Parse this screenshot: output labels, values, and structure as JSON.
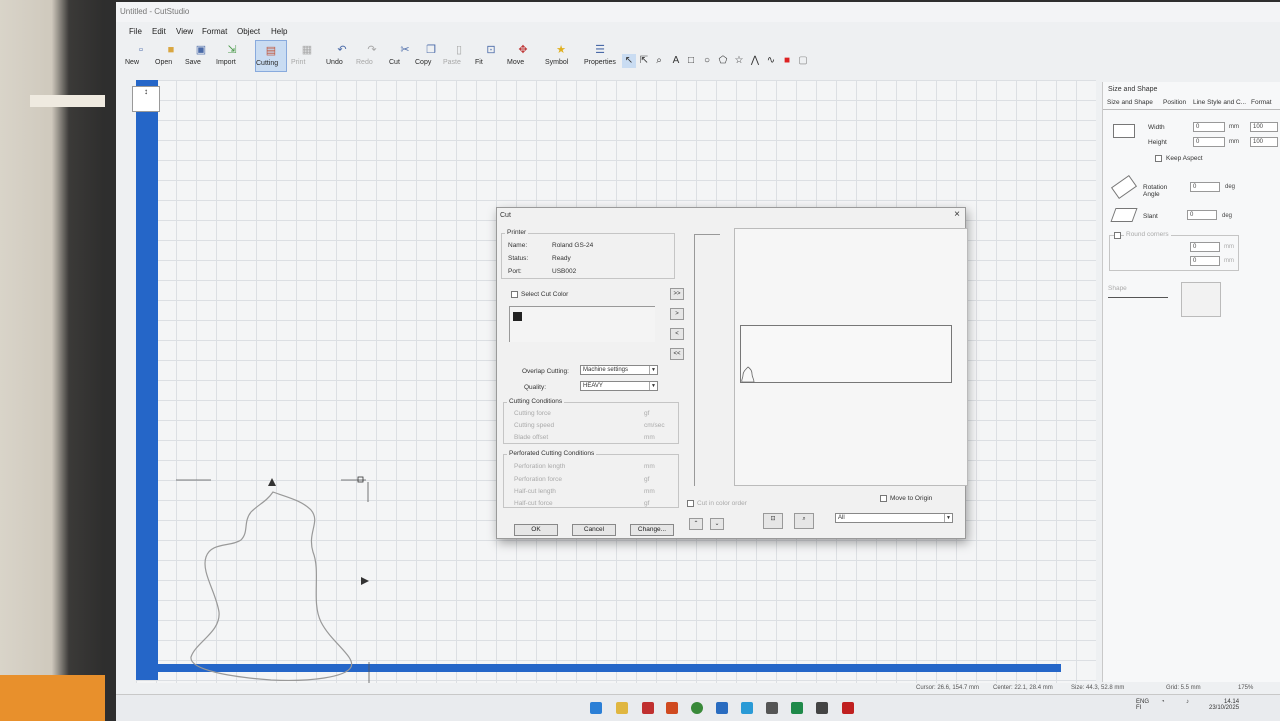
{
  "window": {
    "title": "Untitled - CutStudio"
  },
  "menu": [
    "File",
    "Edit",
    "View",
    "Format",
    "Object",
    "Help"
  ],
  "toolbar": {
    "buttons": [
      {
        "label": "New",
        "icon": "new-file-icon"
      },
      {
        "label": "Open",
        "icon": "folder-open-icon"
      },
      {
        "label": "Save",
        "icon": "save-disk-icon"
      },
      {
        "label": "Import",
        "icon": "import-icon"
      },
      {
        "label": "Cutting",
        "icon": "cutting-plotter-icon"
      },
      {
        "label": "Print",
        "icon": "printer-icon"
      },
      {
        "label": "Undo",
        "icon": "undo-icon"
      },
      {
        "label": "Redo",
        "icon": "redo-icon"
      },
      {
        "label": "Cut",
        "icon": "scissors-icon"
      },
      {
        "label": "Copy",
        "icon": "copy-icon"
      },
      {
        "label": "Paste",
        "icon": "paste-icon"
      },
      {
        "label": "Fit",
        "icon": "fit-icon"
      },
      {
        "label": "Move",
        "icon": "move-icon"
      },
      {
        "label": "Symbol",
        "icon": "star-icon"
      },
      {
        "label": "Properties",
        "icon": "properties-icon"
      }
    ],
    "draw_tools": [
      "pointer-icon",
      "node-edit-icon",
      "zoom-icon",
      "text-icon",
      "rectangle-icon",
      "ellipse-icon",
      "polygon-icon",
      "star-shape-icon",
      "pen-icon",
      "freehand-icon",
      "fill-color-icon",
      "outline-icon"
    ]
  },
  "panel": {
    "title": "Size and Shape",
    "tabs": [
      "Size and Shape",
      "Position",
      "Line Style and C...",
      "Format"
    ],
    "width_label": "Width",
    "height_label": "Height",
    "width_value": "0",
    "height_value": "0",
    "width_pct": "100",
    "height_pct": "100",
    "unit_mm": "mm",
    "keep_aspect": "Keep Aspect",
    "rotation_label": "Rotation Angle",
    "rotation_value": "0",
    "slant_label": "Slant",
    "slant_value": "0",
    "unit_deg": "deg",
    "round_corners": "Round corners",
    "rc_value1": "0",
    "rc_value2": "0",
    "shape_label": "Shape"
  },
  "dialog": {
    "title": "Cut",
    "printer_group": "Printer",
    "name_label": "Name:",
    "name_value": "Roland GS-24",
    "status_label": "Status:",
    "status_value": "Ready",
    "port_label": "Port:",
    "port_value": "USB002",
    "select_cut_color": "Select Cut Color",
    "overlap_label": "Overlap Cutting:",
    "overlap_value": "Machine settings",
    "quality_label": "Quality:",
    "quality_value": "HEAVY",
    "cond_group": "Cutting Conditions",
    "cutting_force": "Cutting force",
    "cutting_speed": "Cutting speed",
    "blade_offset": "Blade offset",
    "unit_gf": "gf",
    "unit_cms": "cm/sec",
    "unit_mm": "mm",
    "perf_group": "Perforated Cutting Conditions",
    "perf_length": "Perforation length",
    "perf_force": "Perforation force",
    "half_cut_length": "Half-cut length",
    "half_cut_force": "Half-cut force",
    "cut_in_color_order": "Cut in color order",
    "move_to_origin": "Move to Origin",
    "filter_value": "All",
    "ok": "OK",
    "cancel": "Cancel",
    "change": "Change...",
    "add_all": ">>",
    "add_one": ">",
    "remove_one": "<",
    "remove_all": "<<"
  },
  "status": {
    "cursor": "Cursor: 26.6, 154.7 mm",
    "center": "Center: 22.1, 28.4 mm",
    "size": "Size: 44.3, 52.8 mm",
    "grid": "Grid: 5.5 mm",
    "zoom": "175%"
  },
  "tray": {
    "lang": "ENG",
    "lang2": "FI",
    "time": "14.14",
    "date": "23/10/2025"
  },
  "colors": {
    "accent": "#2566c8",
    "cut_color_swatch": "#222222"
  }
}
